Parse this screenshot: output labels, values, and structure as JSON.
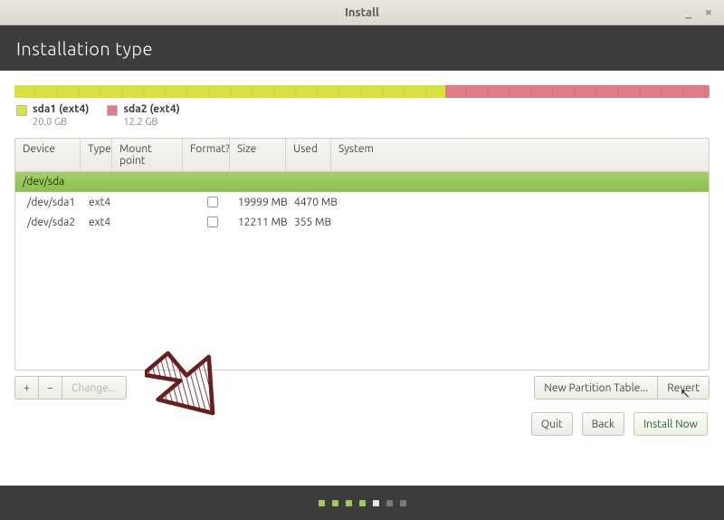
{
  "window": {
    "title": "Install"
  },
  "header": {
    "title": "Installation type"
  },
  "partitions": {
    "legend": [
      {
        "name": "sda1 (ext4)",
        "size": "20.0 GB",
        "swatch": "sw-y"
      },
      {
        "name": "sda2 (ext4)",
        "size": "12.2 GB",
        "swatch": "sw-r"
      }
    ]
  },
  "table": {
    "headers": {
      "device": "Device",
      "type": "Type",
      "mount": "Mount point",
      "format": "Format?",
      "size": "Size",
      "used": "Used",
      "system": "System"
    },
    "group": "/dev/sda",
    "rows": [
      {
        "device": "/dev/sda1",
        "type": "ext4",
        "mount": "",
        "format": false,
        "size": "19999 MB",
        "used": "4470 MB",
        "system": ""
      },
      {
        "device": "/dev/sda2",
        "type": "ext4",
        "mount": "",
        "format": false,
        "size": "12211 MB",
        "used": "355 MB",
        "system": ""
      }
    ]
  },
  "toolbar": {
    "add": "+",
    "remove": "−",
    "change": "Change...",
    "new_table": "New Partition Table...",
    "revert": "Revert"
  },
  "nav": {
    "quit": "Quit",
    "back": "Back",
    "install": "Install Now"
  }
}
